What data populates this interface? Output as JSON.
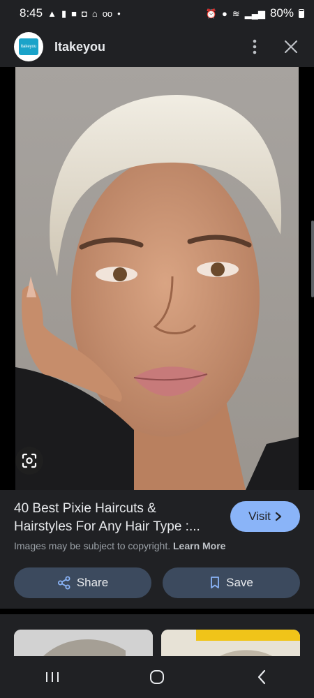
{
  "status_bar": {
    "time": "8:45",
    "battery": "80%"
  },
  "header": {
    "site_name": "Itakeyou",
    "logo_text": "Itakeyou"
  },
  "result": {
    "title_line1": "40 Best Pixie Haircuts &",
    "title_line2": "Hairstyles For Any Hair Type :...",
    "visit_label": "Visit",
    "copyright_text": "Images may be subject to copyright.",
    "learn_more_label": "Learn More",
    "share_label": "Share",
    "save_label": "Save"
  },
  "colors": {
    "accent": "#8ab4f8",
    "panel_bg": "#202124",
    "button_bg": "#3c4a5e"
  },
  "icons": [
    "alarm-icon",
    "location-icon",
    "wifi-icon",
    "signal-icon",
    "battery-icon",
    "more-vert-icon",
    "close-icon",
    "google-lens-icon",
    "share-icon",
    "bookmark-icon",
    "chevron-right-icon",
    "recents-icon",
    "home-icon",
    "back-icon"
  ]
}
